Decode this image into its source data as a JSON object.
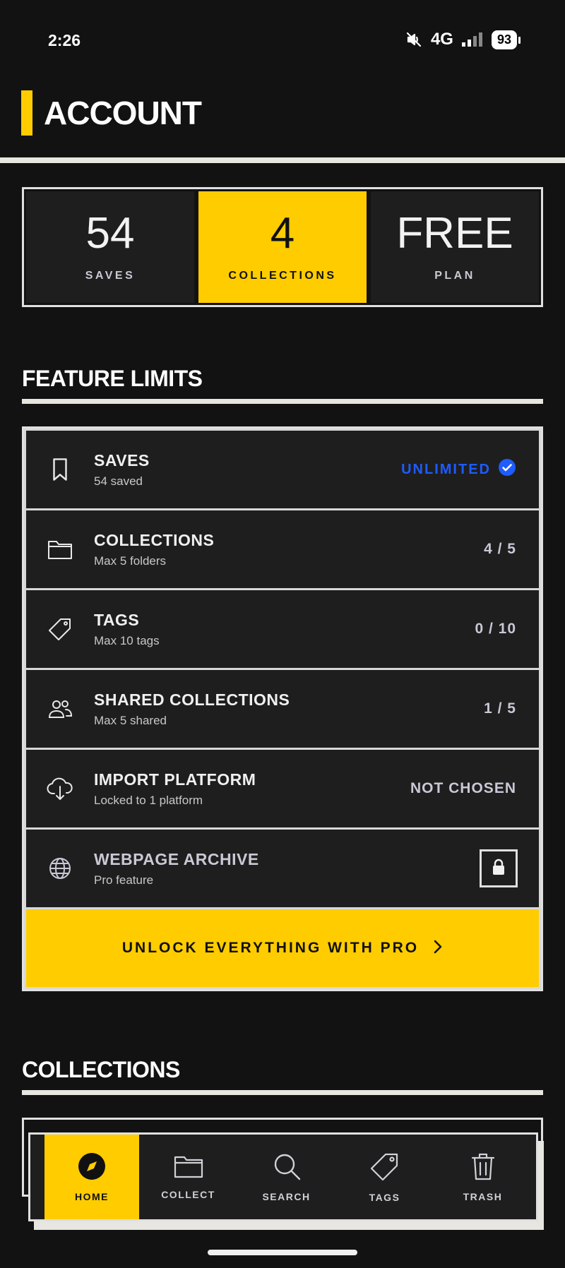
{
  "status_bar": {
    "time": "2:26",
    "network": "4G",
    "battery": "93"
  },
  "header": {
    "title": "ACCOUNT"
  },
  "stats": [
    {
      "value": "54",
      "label": "SAVES",
      "active": false
    },
    {
      "value": "4",
      "label": "COLLECTIONS",
      "active": true
    },
    {
      "value": "FREE",
      "label": "PLAN",
      "active": false
    }
  ],
  "feature_limits": {
    "title": "FEATURE LIMITS",
    "rows": [
      {
        "icon": "bookmark-icon",
        "title": "SAVES",
        "subtitle": "54 saved",
        "value": "UNLIMITED"
      },
      {
        "icon": "folder-icon",
        "title": "COLLECTIONS",
        "subtitle": "Max 5 folders",
        "value": "4 / 5"
      },
      {
        "icon": "tag-icon",
        "title": "TAGS",
        "subtitle": "Max 10 tags",
        "value": "0 / 10"
      },
      {
        "icon": "users-icon",
        "title": "SHARED COLLECTIONS",
        "subtitle": "Max 5 shared",
        "value": "1 / 5"
      },
      {
        "icon": "cloud-download-icon",
        "title": "IMPORT PLATFORM",
        "subtitle": "Locked to 1 platform",
        "value": "NOT CHOSEN"
      },
      {
        "icon": "globe-icon",
        "title": "WEBPAGE ARCHIVE",
        "subtitle": "Pro feature",
        "value": ""
      }
    ],
    "cta_label": "UNLOCK EVERYTHING WITH PRO"
  },
  "collections": {
    "title": "COLLECTIONS"
  },
  "bottom_nav": [
    {
      "label": "HOME",
      "icon": "compass-icon",
      "active": true
    },
    {
      "label": "COLLECT",
      "icon": "folder-icon",
      "active": false
    },
    {
      "label": "SEARCH",
      "icon": "search-icon",
      "active": false
    },
    {
      "label": "TAGS",
      "icon": "tag-icon",
      "active": false
    },
    {
      "label": "TRASH",
      "icon": "trash-icon",
      "active": false
    }
  ],
  "colors": {
    "accent": "#ffcc00",
    "unlimited": "#1e5cff",
    "background": "#121212",
    "card": "#1e1e1e"
  }
}
